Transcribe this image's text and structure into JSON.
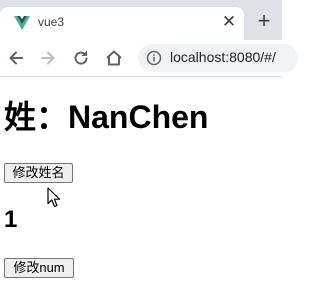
{
  "browser": {
    "tab": {
      "title": "vue3",
      "close_glyph": "✕"
    },
    "new_tab_glyph": "+",
    "address_bar": {
      "url": "localhost:8080/#/"
    },
    "icons": [
      "vue-logo-icon",
      "back-arrow-icon",
      "forward-arrow-icon",
      "reload-icon",
      "home-icon",
      "info-icon",
      "mouse-cursor-icon"
    ],
    "colors": {
      "tabstrip": "#dee1e6",
      "omnibox": "#f1f3f4",
      "vue_green": "#41b883",
      "vue_dark": "#34495e"
    }
  },
  "page": {
    "name_heading": "姓：NanChen",
    "change_name_button": "修改姓名",
    "num_value": "1",
    "change_num_button": "修改num"
  }
}
